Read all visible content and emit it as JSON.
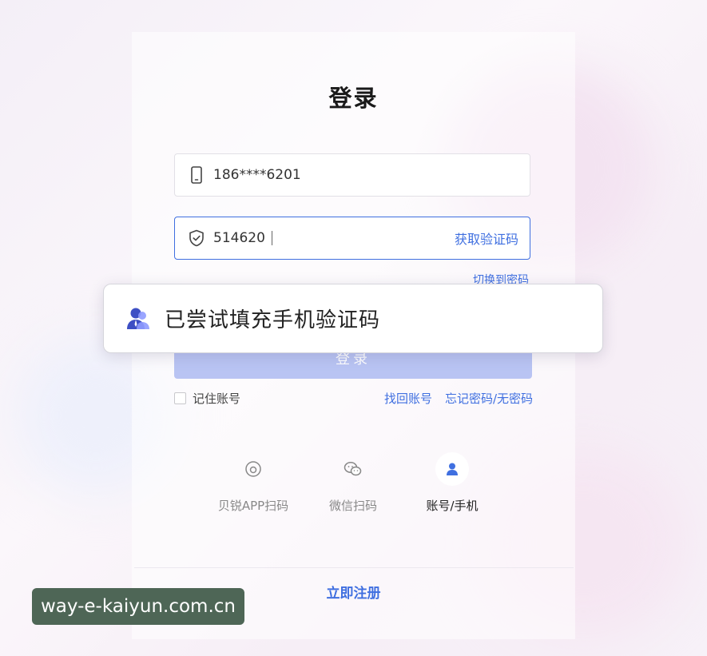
{
  "page": {
    "title": "登录"
  },
  "phone_field": {
    "value": "186****6201",
    "icon": "mobile-phone-icon"
  },
  "code_field": {
    "value": "514620",
    "icon": "shield-check-icon",
    "get_code_label": "获取验证码"
  },
  "switch_to_password": "切换到密码",
  "login_button": "登录",
  "toast": {
    "icon": "user-avatar-icon",
    "message": "已尝试填充手机验证码"
  },
  "remember": {
    "label": "记住账号",
    "checked": false
  },
  "links": {
    "recover_account": "找回账号",
    "forgot_password": "忘记密码/无密码"
  },
  "login_methods": [
    {
      "label": "贝锐APP扫码",
      "icon": "app-scan-icon",
      "active": false
    },
    {
      "label": "微信扫码",
      "icon": "wechat-icon",
      "active": false
    },
    {
      "label": "账号/手机",
      "icon": "user-icon",
      "active": true
    }
  ],
  "register": "立即注册",
  "watermark": "way-e-kaiyun.com.cn",
  "colors": {
    "accent": "#3f6fe0",
    "login_button_disabled": "#b9c4f3",
    "watermark_bg": "#4e6656"
  }
}
